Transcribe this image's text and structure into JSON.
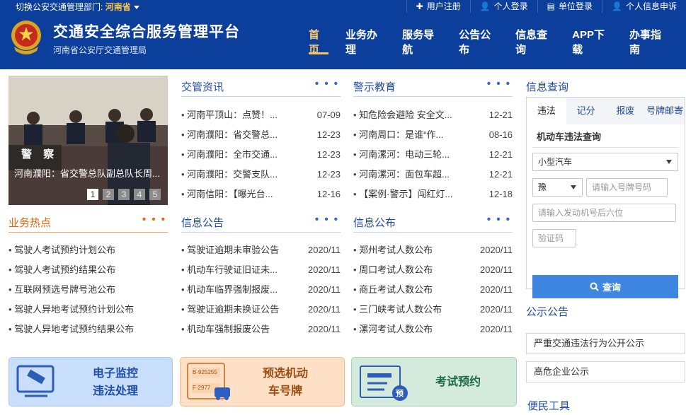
{
  "topbar": {
    "dept_label": "切换公安交通管理部门:",
    "province": "河南省",
    "links": [
      "用户注册",
      "个人登录",
      "单位登录",
      "个人信息申诉"
    ]
  },
  "header": {
    "title": "交通安全综合服务管理平台",
    "subtitle": "河南省公安厅交通管理局",
    "nav": [
      "首页",
      "业务办理",
      "服务导航",
      "公告公布",
      "信息查询",
      "APP下载",
      "办事指南"
    ]
  },
  "banner": {
    "caption": "河南濮阳：省交警总队副总队长周...",
    "dots": [
      "1",
      "2",
      "3",
      "4",
      "5"
    ],
    "sign_text": "警 察"
  },
  "more_label": "• • •",
  "news": {
    "title": "交管资讯",
    "items": [
      {
        "text": "河南平顶山：点赞！...",
        "date": "07-09"
      },
      {
        "text": "河南濮阳：省交警总...",
        "date": "12-23"
      },
      {
        "text": "河南濮阳：全市交通...",
        "date": "12-23"
      },
      {
        "text": "河南濮阳：交警支队...",
        "date": "12-23"
      },
      {
        "text": "河南信阳：【曝光台...",
        "date": "12-16"
      }
    ]
  },
  "warning": {
    "title": "警示教育",
    "items": [
      {
        "text": "知危险会避险 安全文...",
        "date": "12-21"
      },
      {
        "text": "河南周口：是谁“作...",
        "date": "08-16"
      },
      {
        "text": "河南漯河：电动三轮...",
        "date": "12-21"
      },
      {
        "text": "河南漯河：面包车超...",
        "date": "12-21"
      },
      {
        "text": "【案例·警示】闯红灯...",
        "date": "12-18"
      }
    ]
  },
  "hot": {
    "title": "业务热点",
    "items": [
      "驾驶人考试预约计划公布",
      "驾驶人考试预约结果公布",
      "互联网预选号牌号池公布",
      "驾驶人异地考试预约计划公布",
      "驾驶人异地考试预约结果公布"
    ]
  },
  "notice": {
    "title": "信息公告",
    "items": [
      {
        "text": "驾驶证逾期未审验公告",
        "date": "2020/11"
      },
      {
        "text": "机动车行驶证旧证未...",
        "date": "2020/11"
      },
      {
        "text": "机动车临界强制报废...",
        "date": "2020/11"
      },
      {
        "text": "驾驶证逾期未换证公告",
        "date": "2020/11"
      },
      {
        "text": "机动车强制报废公告",
        "date": "2020/11"
      }
    ]
  },
  "publish": {
    "title": "信息公布",
    "items": [
      {
        "text": "郑州考试人数公布",
        "date": "2020/11"
      },
      {
        "text": "周口考试人数公布",
        "date": "2020/11"
      },
      {
        "text": "商丘考试人数公布",
        "date": "2020/11"
      },
      {
        "text": "三门峡考试人数公布",
        "date": "2020/11"
      },
      {
        "text": "漯河考试人数公布",
        "date": "2020/11"
      }
    ]
  },
  "query": {
    "title": "信息查询",
    "tabs": [
      "违法",
      "记分",
      "报废",
      "号牌邮寄"
    ],
    "subtitle": "机动车违法查询",
    "vehicle_type": "小型汽车",
    "plate_prefix": "豫",
    "plate_placeholder": "请输入号牌号码",
    "engine_placeholder": "请输入发动机号后六位",
    "captcha_placeholder": "验证码",
    "button": "查询"
  },
  "public": {
    "title": "公示公告",
    "items": [
      "严重交通违法行为公开公示",
      "高危企业公示"
    ]
  },
  "tools": {
    "title": "便民工具"
  },
  "cards": {
    "monitor": {
      "line1": "电子监控",
      "line2": "违法处理"
    },
    "plate": {
      "line1": "预选机动",
      "line2": "车号牌",
      "tag1": "B·925255",
      "tag2": "F·2977"
    },
    "exam": {
      "line1": "考试预约",
      "badge": "预"
    }
  }
}
